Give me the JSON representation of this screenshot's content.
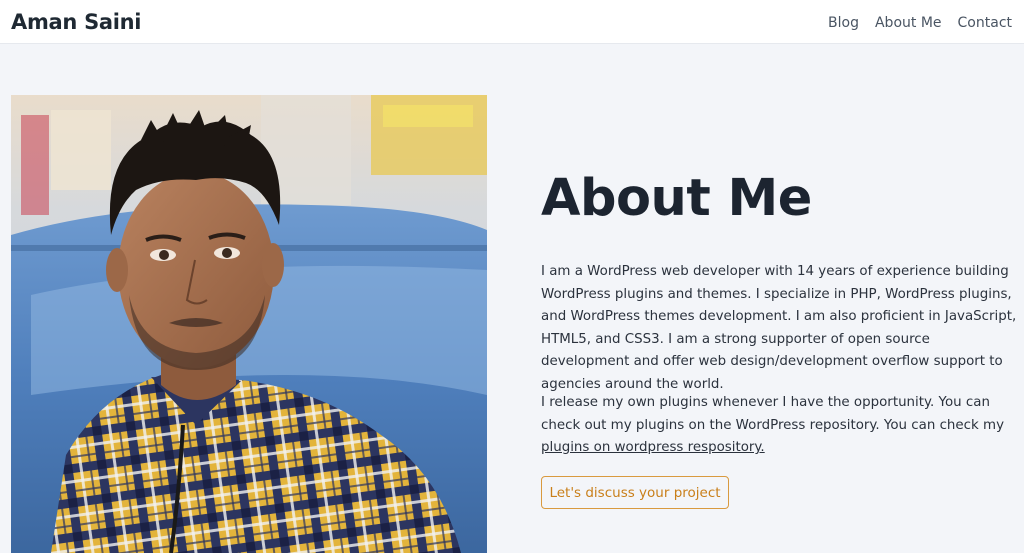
{
  "header": {
    "site_title": "Aman Saini",
    "nav": [
      "Blog",
      "About Me",
      "Contact"
    ]
  },
  "main": {
    "heading": "About Me",
    "paragraph1": "I am a WordPress web developer with 14 years of experience building WordPress plugins and themes. I specialize in PHP, WordPress plugins, and WordPress themes development. I am also proficient in JavaScript, HTML5, and CSS3. I am a strong supporter of open source development and offer web design/development overflow support to agencies around the world.",
    "paragraph2_text": "I release my own plugins whenever I have the opportunity. You can check out my plugins on the WordPress repository. You can check my ",
    "paragraph2_link": "plugins on wordpress respository.",
    "cta_label": "Let's discuss your project"
  },
  "colors": {
    "accent": "#c97f1a",
    "background": "#f3f5f9",
    "heading": "#1c2430"
  }
}
